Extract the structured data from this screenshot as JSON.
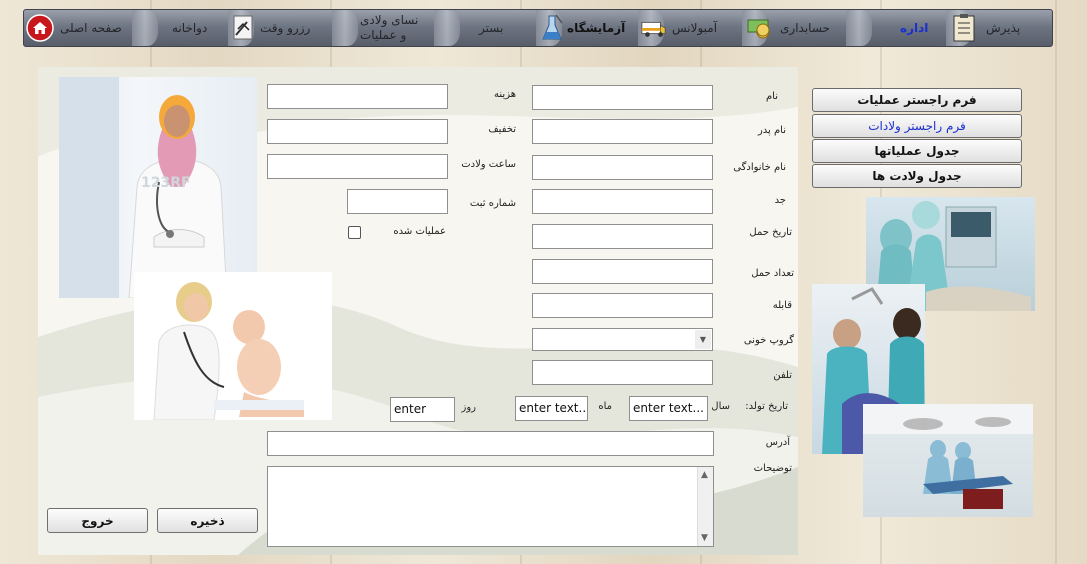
{
  "nav": {
    "items": [
      {
        "label": "پذیرش",
        "icon": "notepad-icon"
      },
      {
        "label": "اداره",
        "icon": "none"
      },
      {
        "label": "حسابداری",
        "icon": "money-icon"
      },
      {
        "label": "آمبولانس",
        "icon": "ambulance-icon"
      },
      {
        "label": "آزمایشگاه",
        "icon": "flask-icon"
      },
      {
        "label": "بستر",
        "icon": "none"
      },
      {
        "label_line1": "نسای ولادی",
        "label_line2": "و عملیات",
        "icon": "none"
      },
      {
        "label": "رزرو وقت",
        "icon": "document-icon"
      },
      {
        "label": "دواخانه",
        "icon": "none"
      },
      {
        "label": "صفحه اصلی",
        "icon": "home-icon"
      }
    ],
    "active_index": 1
  },
  "side_menu": [
    {
      "label": "فرم راجستر عملیات"
    },
    {
      "label": "فرم راجستر ولادات"
    },
    {
      "label": "جدول عملیاتها"
    },
    {
      "label": "جدول ولادت ها"
    }
  ],
  "form": {
    "name_label": "نام",
    "father_label": "نام پدر",
    "family_label": "نام خانوادگی",
    "grandfather_label": "جد",
    "pregnancy_date_label": "تاریخ حمل",
    "pregnancy_count_label": "تعداد حمل",
    "midwife_label": "قابله",
    "blood_group_label": "گروپ خونی",
    "phone_label": "تلفن",
    "birth_date_label": "تاریخ تولد:",
    "year_label": "سال",
    "month_label": "ماه",
    "day_label": "روز",
    "year_value": "enter text...",
    "month_value": "enter text...",
    "day_value": "enter",
    "address_label": "آدرس",
    "notes_label": "توضیحات",
    "cost_label": "هزینه",
    "discount_label": "تخفیف",
    "birth_time_label": "ساعت ولادت",
    "reg_number_label": "شماره ثبت",
    "operated_label": "عملیات شده",
    "save_label": "ذخیره",
    "exit_label": "خروج"
  },
  "images": {
    "doctor_watermark": "123RF",
    "photo1": "doctor-woman-photo",
    "photo2": "pediatrician-baby-photo",
    "photo3": "operating-room-photo",
    "photo4": "dental-surgery-photo",
    "photo5": "surgical-theatre-photo"
  },
  "colors": {
    "nav_dark": "#575d69",
    "active_text": "#1a2fd0",
    "panel_bg": "#f7f6f1",
    "home_icon": "#c8161d"
  }
}
